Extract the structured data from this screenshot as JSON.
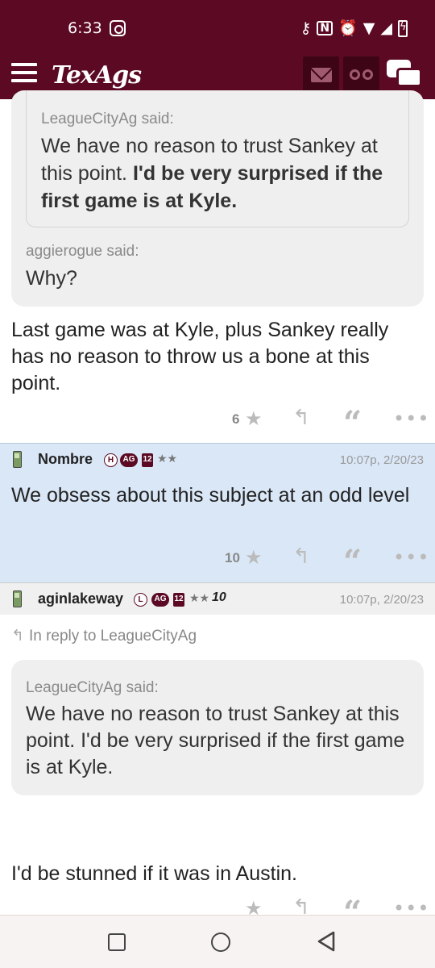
{
  "status_bar": {
    "time": "6:33",
    "icons": [
      "record-icon",
      "key-icon",
      "nfc-icon",
      "alarm-icon",
      "wifi-icon",
      "signal-icon",
      "battery-icon"
    ]
  },
  "app_bar": {
    "logo": "TexAgs",
    "buttons": [
      "menu-icon",
      "mail-icon",
      "binoculars-icon",
      "chat-icon"
    ]
  },
  "post1": {
    "nested_quote": {
      "author": "LeagueCityAg said:",
      "text_plain": "We have no reason to trust Sankey at this point. ",
      "text_bold": "I'd be very surprised if the first game is at Kyle."
    },
    "quote": {
      "author": "aggierogue said:",
      "text": "Why?"
    },
    "body": "Last game was at Kyle, plus Sankey really has no reason to throw us a bone at this point.",
    "likes": "6"
  },
  "post2": {
    "username": "Nombre",
    "badges": [
      "H",
      "AG",
      "12"
    ],
    "stars": "★★",
    "timestamp": "10:07p, 2/20/23",
    "body": "We obsess about this subject at an odd level",
    "likes": "10"
  },
  "post3": {
    "username": "aginlakeway",
    "badges": [
      "L",
      "AG",
      "12"
    ],
    "stars": "★★",
    "extra": "10",
    "timestamp": "10:07p, 2/20/23",
    "in_reply": "In reply to LeagueCityAg",
    "quote": {
      "author": "LeagueCityAg said:",
      "text": "We have no reason to trust Sankey at this point. I'd be very surprised if the first game is at Kyle."
    },
    "body": "I'd be stunned if it was in Austin."
  },
  "colors": {
    "brand": "#5c0a24",
    "highlight": "#dae7f7",
    "quote_bg": "#efefef"
  }
}
